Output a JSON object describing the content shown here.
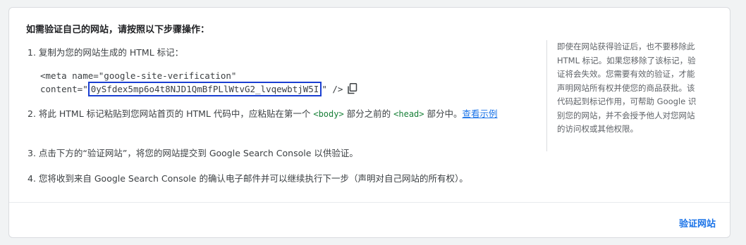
{
  "heading": "如需验证自己的网站，请按照以下步骤操作：",
  "steps": {
    "step1": "1. 复制为您的网站生成的 HTML 标记：",
    "step2": {
      "prefix": "2. 将此 HTML 标记粘贴到您网站首页的 HTML 代码中，应粘贴在第一个 ",
      "tag_body": "<body>",
      "middle": " 部分之前的 ",
      "tag_head": "<head>",
      "suffix": " 部分中。",
      "link": "查看示例"
    },
    "step3": "3. 点击下方的“验证网站”，将您的网站提交到 Google Search Console 以供验证。",
    "step4": "4. 您将收到来自 Google Search Console 的确认电子邮件并可以继续执行下一步（声明对自己网站的所有权）。"
  },
  "code": {
    "line1": "<meta name=\"google-site-verification\"",
    "line2_prefix": "content=\"",
    "token": "0ySfdex5mp6o4t8NJD1QmBfPLlWtvG2_lvqewbtjW5I",
    "line2_suffix": "\" />"
  },
  "side_note": "即使在网站获得验证后，也不要移除此 HTML 标记。如果您移除了该标记，验证将会失效。您需要有效的验证，才能声明网站所有权并使您的商品获批。该代码起到标记作用，可帮助 Google 识别您的网站，并不会授予他人对您网站的访问权或其他权限。",
  "verify_button": "验证网站",
  "colors": {
    "accent": "#1a73e8",
    "highlight_box": "#1a3fd1",
    "tag_green": "#188038"
  },
  "icons": {
    "copy": "copy-icon"
  }
}
